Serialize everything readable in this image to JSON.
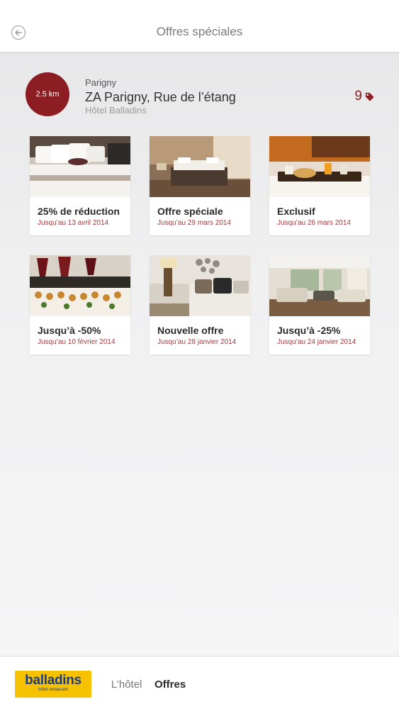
{
  "header": {
    "title": "Offres spéciales"
  },
  "hotel": {
    "distance": "2.5 km",
    "city": "Parigny",
    "address": "ZA Parigny, Rue de l’étang",
    "name": "Hôtel Balladins",
    "offers_count": "9"
  },
  "offers": [
    {
      "title": "25% de réduction",
      "date": "Jusqu’au 13 avril 2014",
      "image": "bedroom-photo"
    },
    {
      "title": "Offre spéciale",
      "date": "Jusqu’au 29 mars 2014",
      "image": "hotel-room-photo"
    },
    {
      "title": "Exclusif",
      "date": "Jusqu’au 26 mars 2014",
      "image": "breakfast-tray-photo"
    },
    {
      "title": "Jusqu’à -50%",
      "date": "Jusqu’au 10 février 2014",
      "image": "wine-canapes-photo"
    },
    {
      "title": "Nouvelle offre",
      "date": "Jusqu’au 28 janvier 2014",
      "image": "decorated-bedroom-photo"
    },
    {
      "title": "Jusqu’à -25%",
      "date": "Jusqu’au 24 janvier 2014",
      "image": "living-room-photo"
    }
  ],
  "footer": {
    "logo_main": "balladins",
    "logo_sub": "hôtel restaurant",
    "nav_hotel": "L’hôtel",
    "nav_offers": "Offres"
  },
  "colors": {
    "accent": "#8c1d22",
    "logo_bg": "#f6c100",
    "logo_text": "#1a3c8c"
  }
}
